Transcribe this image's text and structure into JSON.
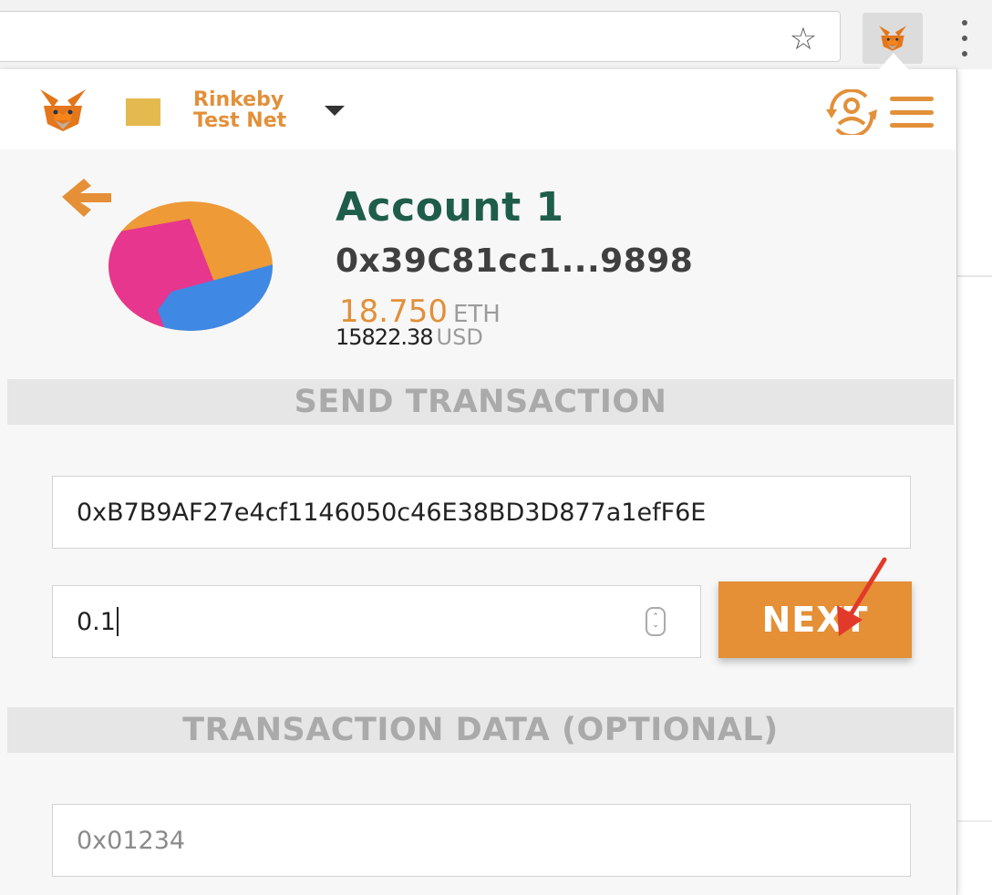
{
  "browser": {
    "bookmark_icon": "star-icon",
    "extension_icon": "metamask-fox-icon",
    "menu_icon": "kebab-menu-icon"
  },
  "header": {
    "network_line1": "Rinkeby",
    "network_line2": "Test Net",
    "network_color": "#e4b94f",
    "accent_color": "#e2903a"
  },
  "account": {
    "name": "Account 1",
    "address": "0x39C81cc1...9898",
    "eth_balance": "18.750",
    "eth_unit": "ETH",
    "usd_balance": "15822.38",
    "usd_unit": "USD"
  },
  "send": {
    "section_title": "SEND TRANSACTION",
    "recipient_value": "0xB7B9AF27e4cf1146050c46E38BD3D877a1efF6E",
    "amount_value": "0.1",
    "next_label": "NEXT",
    "next_color": "#e58f36"
  },
  "data": {
    "section_title": "TRANSACTION DATA (OPTIONAL)",
    "placeholder": "0x01234"
  }
}
